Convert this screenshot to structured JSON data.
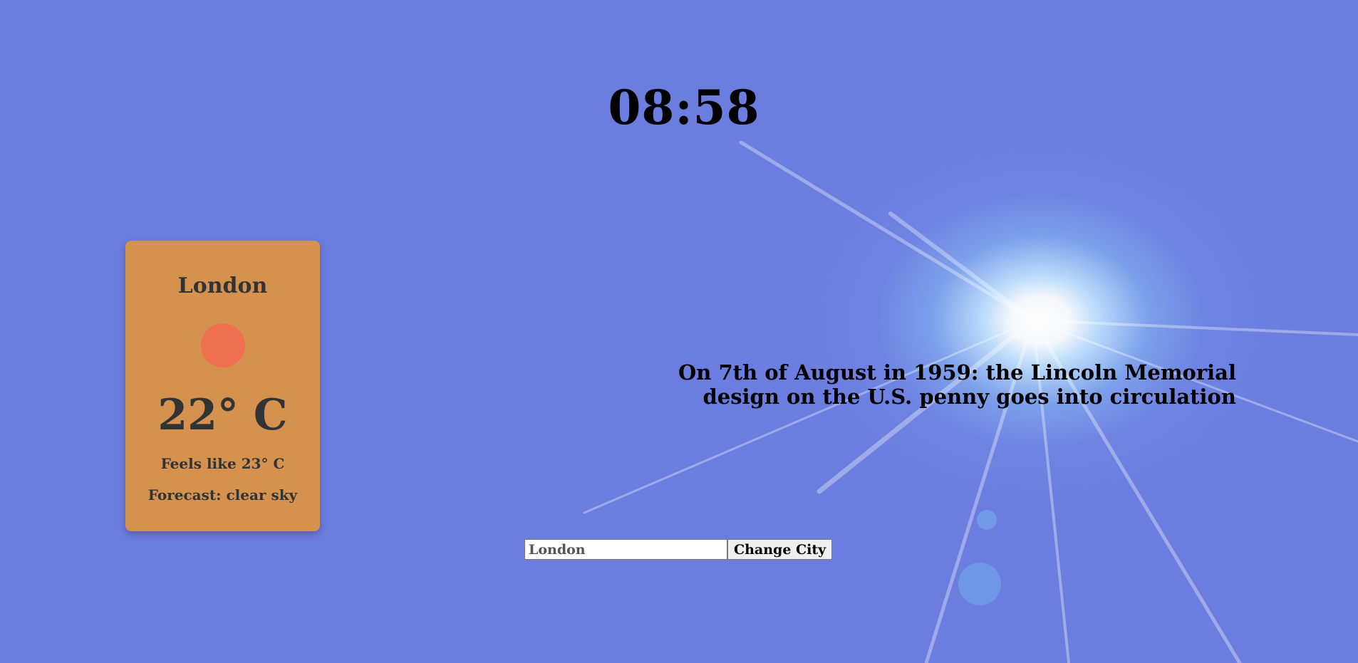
{
  "clock": {
    "time": "08:58"
  },
  "weather": {
    "city": "London",
    "icon": "sun-icon",
    "icon_color": "#ee7050",
    "temperature": "22° C",
    "feels_like": "Feels like 23° C",
    "forecast": "Forecast: clear sky",
    "card_color": "#d5924f"
  },
  "fact": {
    "line1": "On 7th of August in 1959: the Lincoln Memorial",
    "line2": "design on the U.S. penny goes into circulation"
  },
  "city_form": {
    "input_value": "London",
    "button_label": "Change City"
  },
  "theme": {
    "background": "#6b7ddf"
  }
}
